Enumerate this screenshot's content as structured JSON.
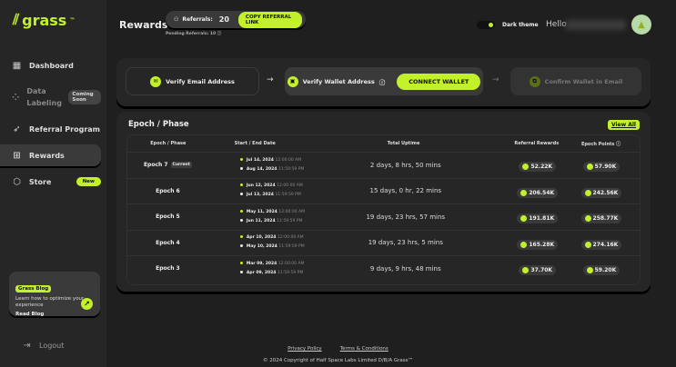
{
  "logo": {
    "text": "grass",
    "tm": "™"
  },
  "sidebar": {
    "items": [
      {
        "label": "Dashboard",
        "icon": "grid-icon"
      },
      {
        "label": "Data Labeling",
        "badge": "Coming Soon",
        "icon": "labeling-icon"
      },
      {
        "label": "Referral Program",
        "icon": "rocket-icon"
      },
      {
        "label": "Rewards",
        "icon": "gift-icon"
      },
      {
        "label": "Store",
        "badge": "New",
        "icon": "cube-icon"
      }
    ],
    "blog": {
      "tag": "Grass Blog",
      "text": "Learn how to optimize your experience",
      "link": "Read Blog"
    },
    "logout": "Logout"
  },
  "header": {
    "title": "Rewards",
    "referrals_label": "Referrals:",
    "referrals_count": "20",
    "copy_label": "COPY REFERRAL LINK",
    "pending": "Pending Referrals: 10",
    "theme_label": "Dark theme",
    "hello": "Hello"
  },
  "verify": {
    "step1": "Verify Email Address",
    "step2": "Verify Wallet Address",
    "connect": "CONNECT WALLET",
    "step3": "Confirm Wallet in Email"
  },
  "epochs": {
    "title": "Epoch / Phase",
    "view_all": "View All",
    "columns": [
      "Epoch / Phase",
      "Start / End Date",
      "Total Uptime",
      "Referral Rewards",
      "Epoch Points"
    ],
    "rows": [
      {
        "epoch": "Epoch 7",
        "badge": "Current",
        "start": "Jul 14, 2024",
        "start_time": "12:00:00 AM",
        "end": "Aug 14, 2024",
        "end_time": "11:59:59 PM",
        "uptime": "2 days, 8 hrs, 50 mins",
        "referral": "52.22K",
        "points": "57.90K"
      },
      {
        "epoch": "Epoch 6",
        "start": "Jun 12, 2024",
        "start_time": "12:00:00 AM",
        "end": "Jul 13, 2024",
        "end_time": "11:59:59 PM",
        "uptime": "15 days, 0 hr, 22 mins",
        "referral": "206.54K",
        "points": "242.56K"
      },
      {
        "epoch": "Epoch 5",
        "start": "May 11, 2024",
        "start_time": "12:00:00 AM",
        "end": "Jun 11, 2024",
        "end_time": "11:59:59 PM",
        "uptime": "19 days, 23 hrs, 57 mins",
        "referral": "191.81K",
        "points": "258.77K"
      },
      {
        "epoch": "Epoch 4",
        "start": "Apr 10, 2024",
        "start_time": "12:00:00 AM",
        "end": "May 10, 2024",
        "end_time": "11:59:59 PM",
        "uptime": "19 days, 23 hrs, 5 mins",
        "referral": "165.28K",
        "points": "274.16K"
      },
      {
        "epoch": "Epoch 3",
        "start": "Mar 09, 2024",
        "start_time": "12:00:00 AM",
        "end": "Apr 09, 2024",
        "end_time": "11:59:59 PM",
        "uptime": "9 days, 9 hrs, 48 mins",
        "referral": "37.70K",
        "points": "59.20K"
      }
    ]
  },
  "footer": {
    "privacy": "Privacy Policy",
    "terms": "Terms & Conditions",
    "copyright": "© 2024 Copyright of Half Space Labs Limited D/B/A Grass™"
  },
  "colors": {
    "accent": "#c2f12b",
    "background": "#1f1f1f",
    "sidebar": "#262626"
  }
}
